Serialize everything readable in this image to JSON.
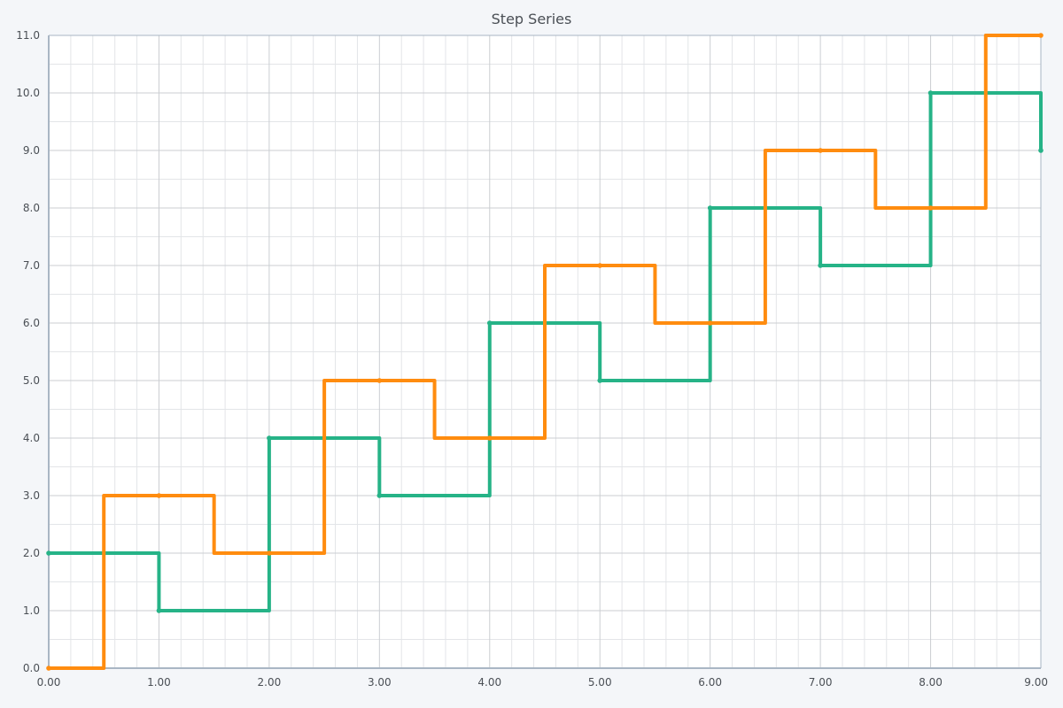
{
  "chart_data": {
    "type": "line",
    "title": "Step Series",
    "xlabel": "",
    "ylabel": "",
    "xlim": [
      0,
      9
    ],
    "ylim": [
      0,
      11
    ],
    "x_ticks": [
      "0.00",
      "1.00",
      "2.00",
      "3.00",
      "4.00",
      "5.00",
      "6.00",
      "7.00",
      "8.00",
      "9.00"
    ],
    "y_ticks": [
      "0.0",
      "1.0",
      "2.0",
      "3.0",
      "4.0",
      "5.0",
      "6.0",
      "7.0",
      "8.0",
      "9.0",
      "10.0",
      "11.0"
    ],
    "grid": true,
    "series": [
      {
        "color": "#26b387",
        "step": "after",
        "x": [
          0,
          1,
          2,
          3,
          4,
          5,
          6,
          7,
          8,
          9
        ],
        "y": [
          2,
          1,
          4,
          3,
          6,
          5,
          8,
          7,
          10,
          9
        ]
      },
      {
        "color": "#ff8c0f",
        "step": "mid",
        "x": [
          0,
          1,
          2,
          3,
          4,
          5,
          6,
          7,
          8,
          9
        ],
        "y": [
          0,
          3,
          2,
          5,
          4,
          7,
          6,
          9,
          8,
          11
        ]
      }
    ]
  }
}
